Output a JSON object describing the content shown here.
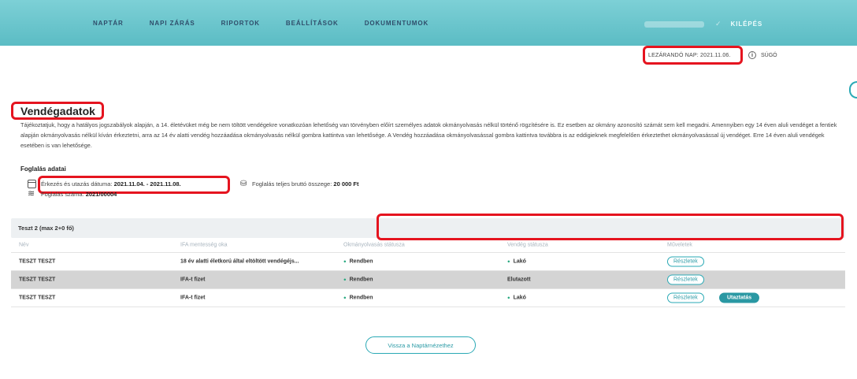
{
  "nav": {
    "items": [
      "NAPTÁR",
      "NAPI ZÁRÁS",
      "RIPORTOK",
      "BEÁLLÍTÁSOK",
      "DOKUMENTUMOK"
    ],
    "logout": "KILÉPÉS"
  },
  "closing": {
    "label": "LEZÁRANDÓ NAP: 2021.11.06.",
    "info": "i",
    "help": "SÚGÓ"
  },
  "page": {
    "title": "Vendégadatok",
    "intro": "Tájékoztatjuk, hogy a hatályos jogszabályok alapján, a 14. életévüket még be nem töltött vendégekre vonatkozóan lehetőség van törvényben előírt személyes adatok okmányolvasás nélkül történő rögzítésére is. Ez esetben az okmány azonosító számát sem kell megadni. Amennyiben egy 14 éven aluli vendéget a fentiek alapján okmányolvasás nélkül kíván érkeztetni, arra az 14 év alatti vendég hozzáadása okmányolvasás nélkül gombra kattintva van lehetősége. A Vendég hozzáadása okmányolvasással gombra kattintva továbbra is az eddigieknek megfelelően érkeztethet okmányolvasással új vendéget. Erre 14 éven aluli vendégek esetében is van lehetősége."
  },
  "booking": {
    "heading": "Foglalás adatai",
    "arrival_label": "Érkezés és utazás dátuma:",
    "arrival_value": "2021.11.04. - 2021.11.08.",
    "total_label": "Foglalás teljes bruttó összege:",
    "total_value": "20 000 Ft",
    "number_label": "Foglalás száma:",
    "number_value": "2021/00004"
  },
  "room": {
    "title": "Teszt 2 (max 2+0 fő)",
    "columns": [
      "Név",
      "IFA mentesség oka",
      "Okmányolvasás státusza",
      "Vendég státusza",
      "Műveletek"
    ],
    "rows": [
      {
        "name": "TESZT TESZT",
        "ifa": "18 év alatti életkorú által eltöltött vendégéjs...",
        "doc": "Rendben",
        "guest": "Lakó",
        "details": "Részletek",
        "extra": ""
      },
      {
        "name": "TESZT TESZT",
        "ifa": "IFA-t fizet",
        "doc": "Rendben",
        "guest": "Elutazott",
        "details": "Részletek",
        "extra": ""
      },
      {
        "name": "TESZT TESZT",
        "ifa": "IFA-t fizet",
        "doc": "Rendben",
        "guest": "Lakó",
        "details": "Részletek",
        "extra": "Utaztatás"
      }
    ]
  },
  "back_button": "Vissza a Naptárnézethez",
  "colors": {
    "accent": "#2aa9b5",
    "topbar": "#6cc6cd",
    "highlight": "#e5141f",
    "status_ok": "#28a980"
  }
}
